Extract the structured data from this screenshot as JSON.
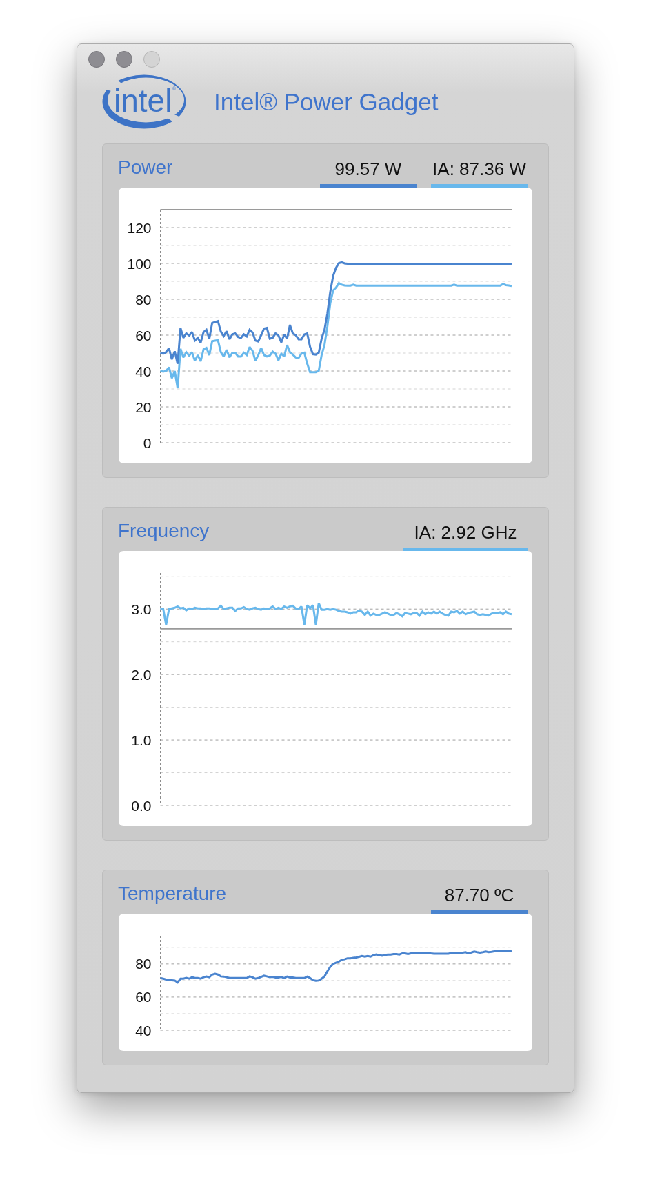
{
  "window": {
    "controls": [
      {
        "disabled": false
      },
      {
        "disabled": false
      },
      {
        "disabled": true
      }
    ],
    "logo": {
      "text": "intel",
      "mark": "®"
    },
    "title": "Intel® Power Gadget"
  },
  "panels": [
    {
      "title": "Power",
      "readouts": [
        {
          "text": "99.57 W",
          "color": "#4a84cf"
        },
        {
          "text": "IA: 87.36 W",
          "color": "#68b8ec"
        }
      ],
      "chart_data": {
        "type": "line",
        "ylim": [
          0,
          130
        ],
        "yticks": [
          0,
          20,
          40,
          60,
          80,
          100,
          120
        ],
        "grid": true,
        "ref_lines": [
          {
            "axis": "y",
            "value": 130
          }
        ],
        "series": [
          {
            "color": "#4a84cf",
            "values": [
              50.2,
              49.7,
              50.5,
              52.7,
              46.5,
              51,
              44,
              64,
              58.5,
              61,
              59.8,
              61.7,
              57,
              58.5,
              55.8,
              61.7,
              63,
              58,
              66.8,
              67.3,
              67.8,
              62,
              59.5,
              62.2,
              57.7,
              60.5,
              61,
              59,
              58.5,
              60.5,
              59.3,
              63,
              61.5,
              57,
              56.5,
              60,
              63.6,
              64,
              58,
              58.5,
              61,
              59.8,
              56,
              60.4,
              58,
              65.7,
              61,
              60,
              57.7,
              57.7,
              60.4,
              61,
              53.4,
              49.4,
              49.2,
              50.2,
              58,
              63,
              72,
              84,
              93,
              97.5,
              100.2,
              100.6,
              100,
              99.8,
              99.8,
              99.8,
              99.8,
              99.8,
              99.8,
              99.8,
              99.8,
              99.8,
              99.8,
              99.8,
              99.8,
              99.8,
              99.8,
              99.8,
              99.8,
              99.8,
              99.8,
              99.8,
              99.8,
              99.8,
              99.8,
              99.8,
              99.8,
              99.8,
              99.8,
              99.8,
              99.8,
              99.8,
              99.8,
              99.8,
              99.8,
              99.8,
              99.8,
              99.8,
              99.8,
              99.8,
              99.8,
              99.8,
              99.8,
              99.8,
              99.8,
              99.8,
              99.8,
              99.8,
              99.8,
              99.8,
              99.8,
              99.8,
              99.8,
              99.8,
              99.8,
              99.8,
              99.8,
              99.8,
              99.8,
              99.8,
              99.6
            ]
          },
          {
            "color": "#68b8ec",
            "values": [
              40.1,
              39.6,
              40,
              42.1,
              36,
              40,
              30.4,
              52.4,
              47.6,
              50.5,
              48.6,
              50.5,
              45.7,
              48.9,
              45.4,
              52.1,
              52.9,
              48.9,
              56.6,
              56.9,
              57.2,
              50.5,
              48.1,
              51.8,
              47.6,
              50.2,
              50.2,
              48.1,
              48.1,
              50.2,
              48.9,
              53.4,
              51.3,
              45.7,
              48.9,
              52.9,
              48.9,
              48.1,
              48.6,
              50.8,
              49.7,
              46,
              49.7,
              48.1,
              54.5,
              50.5,
              49.2,
              47.6,
              47.3,
              49.7,
              50.2,
              44.1,
              39.3,
              39.3,
              39.3,
              40.1,
              48.9,
              54.5,
              64.9,
              77.7,
              84.9,
              86.5,
              89,
              88.1,
              87.7,
              87.6,
              87.6,
              88.1,
              87.6,
              87.6,
              87.6,
              87.6,
              87.6,
              87.6,
              87.6,
              87.6,
              87.6,
              87.6,
              87.6,
              87.6,
              87.6,
              87.6,
              87.6,
              87.6,
              87.6,
              87.6,
              87.6,
              87.6,
              87.6,
              87.6,
              87.6,
              87.6,
              87.6,
              87.6,
              87.6,
              87.6,
              87.6,
              87.6,
              87.6,
              87.6,
              87.6,
              87.6,
              88.1,
              87.6,
              87.6,
              87.6,
              87.6,
              87.6,
              87.6,
              87.6,
              87.6,
              87.6,
              87.6,
              87.6,
              87.6,
              87.6,
              87.6,
              87.6,
              87.6,
              88.5,
              87.9,
              87.7,
              87.4
            ]
          }
        ]
      }
    },
    {
      "title": "Frequency",
      "readouts": [
        {
          "text": "IA: 2.92 GHz",
          "color": "#68b8ec"
        }
      ],
      "chart_data": {
        "type": "line",
        "ylim": [
          0,
          3.55
        ],
        "yticks": [
          {
            "value": 0,
            "label": "0.0"
          },
          {
            "value": 1,
            "label": "1.0"
          },
          {
            "value": 2,
            "label": "2.0"
          },
          {
            "value": 3,
            "label": "3.0"
          }
        ],
        "grid": true,
        "ref_lines": [
          {
            "axis": "y",
            "value": 2.7
          }
        ],
        "series": [
          {
            "color": "#68b8ec",
            "values": [
              3.01,
              3,
              2.76,
              3,
              3.01,
              3.02,
              3.04,
              3.01,
              3.02,
              2.98,
              3.01,
              3,
              3.02,
              3.01,
              3.01,
              3,
              3.01,
              3.01,
              3,
              3,
              3.01,
              3.05,
              3,
              3.01,
              3.02,
              3.02,
              2.97,
              3.01,
              3.01,
              3.03,
              3,
              2.99,
              3.01,
              3.02,
              3,
              2.99,
              3.01,
              3,
              3.01,
              3.04,
              3,
              3.02,
              3,
              3.04,
              3.02,
              3.04,
              3.05,
              3.01,
              3,
              3.04,
              2.76,
              3.06,
              3.01,
              3.06,
              2.76,
              3.09,
              2.99,
              2.99,
              3,
              2.99,
              3,
              2.99,
              2.97,
              2.96,
              2.96,
              2.95,
              2.93,
              2.95,
              2.95,
              2.98,
              2.96,
              2.91,
              2.96,
              2.9,
              2.93,
              2.91,
              2.91,
              2.93,
              2.95,
              2.93,
              2.91,
              2.91,
              2.94,
              2.92,
              2.89,
              2.94,
              2.93,
              2.92,
              2.94,
              2.94,
              2.9,
              2.96,
              2.92,
              2.95,
              2.93,
              2.96,
              2.93,
              2.96,
              2.93,
              2.91,
              2.9,
              2.96,
              2.95,
              2.97,
              2.93,
              2.96,
              2.92,
              2.94,
              2.95,
              2.96,
              2.92,
              2.91,
              2.92,
              2.91,
              2.9,
              2.93,
              2.94,
              2.94,
              2.95,
              2.92,
              2.96,
              2.93,
              2.92
            ]
          }
        ]
      }
    },
    {
      "title": "Temperature",
      "readouts": [
        {
          "text": "87.70 ºC",
          "color": "#4a84cf"
        }
      ],
      "chart_data": {
        "type": "line",
        "ylim": [
          40,
          97
        ],
        "yticks": [
          40,
          60,
          80
        ],
        "grid": true,
        "series": [
          {
            "color": "#4a84cf",
            "values": [
              71.5,
              71.1,
              70.6,
              70.4,
              70.2,
              70,
              68.8,
              71.1,
              71.1,
              71.6,
              71.1,
              72,
              71.5,
              71.5,
              71.1,
              72,
              72.4,
              72,
              73.6,
              74.1,
              73.6,
              72.5,
              72.4,
              72,
              71.5,
              71.5,
              71.5,
              71.5,
              71.5,
              71.5,
              71.5,
              72.5,
              72,
              71.1,
              71.5,
              72.2,
              72.9,
              72.5,
              72,
              72.2,
              71.8,
              71.8,
              72.2,
              71.5,
              72.4,
              71.8,
              71.8,
              71.5,
              71.5,
              71.5,
              71.5,
              72.4,
              71.5,
              70.2,
              69.9,
              70,
              71.1,
              72.5,
              75.6,
              78.2,
              80,
              80.7,
              81.4,
              82.5,
              82.8,
              83.4,
              83.4,
              83.7,
              83.9,
              84.3,
              84.8,
              84.4,
              84.8,
              84.4,
              85.3,
              85.7,
              85.3,
              85,
              85.5,
              85.7,
              85.7,
              86,
              86,
              85.7,
              86.4,
              86.4,
              86,
              86.4,
              86.4,
              86.4,
              86.4,
              86.4,
              86.4,
              86.8,
              86.4,
              86.2,
              86.2,
              86.2,
              86.2,
              86.2,
              86.2,
              86.6,
              86.8,
              86.8,
              86.8,
              86.8,
              87.1,
              86.4,
              86.9,
              87.5,
              87.1,
              86.8,
              87.1,
              87.5,
              87.1,
              87.3,
              87.6,
              87.6,
              87.6,
              87.6,
              87.6,
              87.6,
              87.9
            ]
          }
        ]
      }
    }
  ]
}
